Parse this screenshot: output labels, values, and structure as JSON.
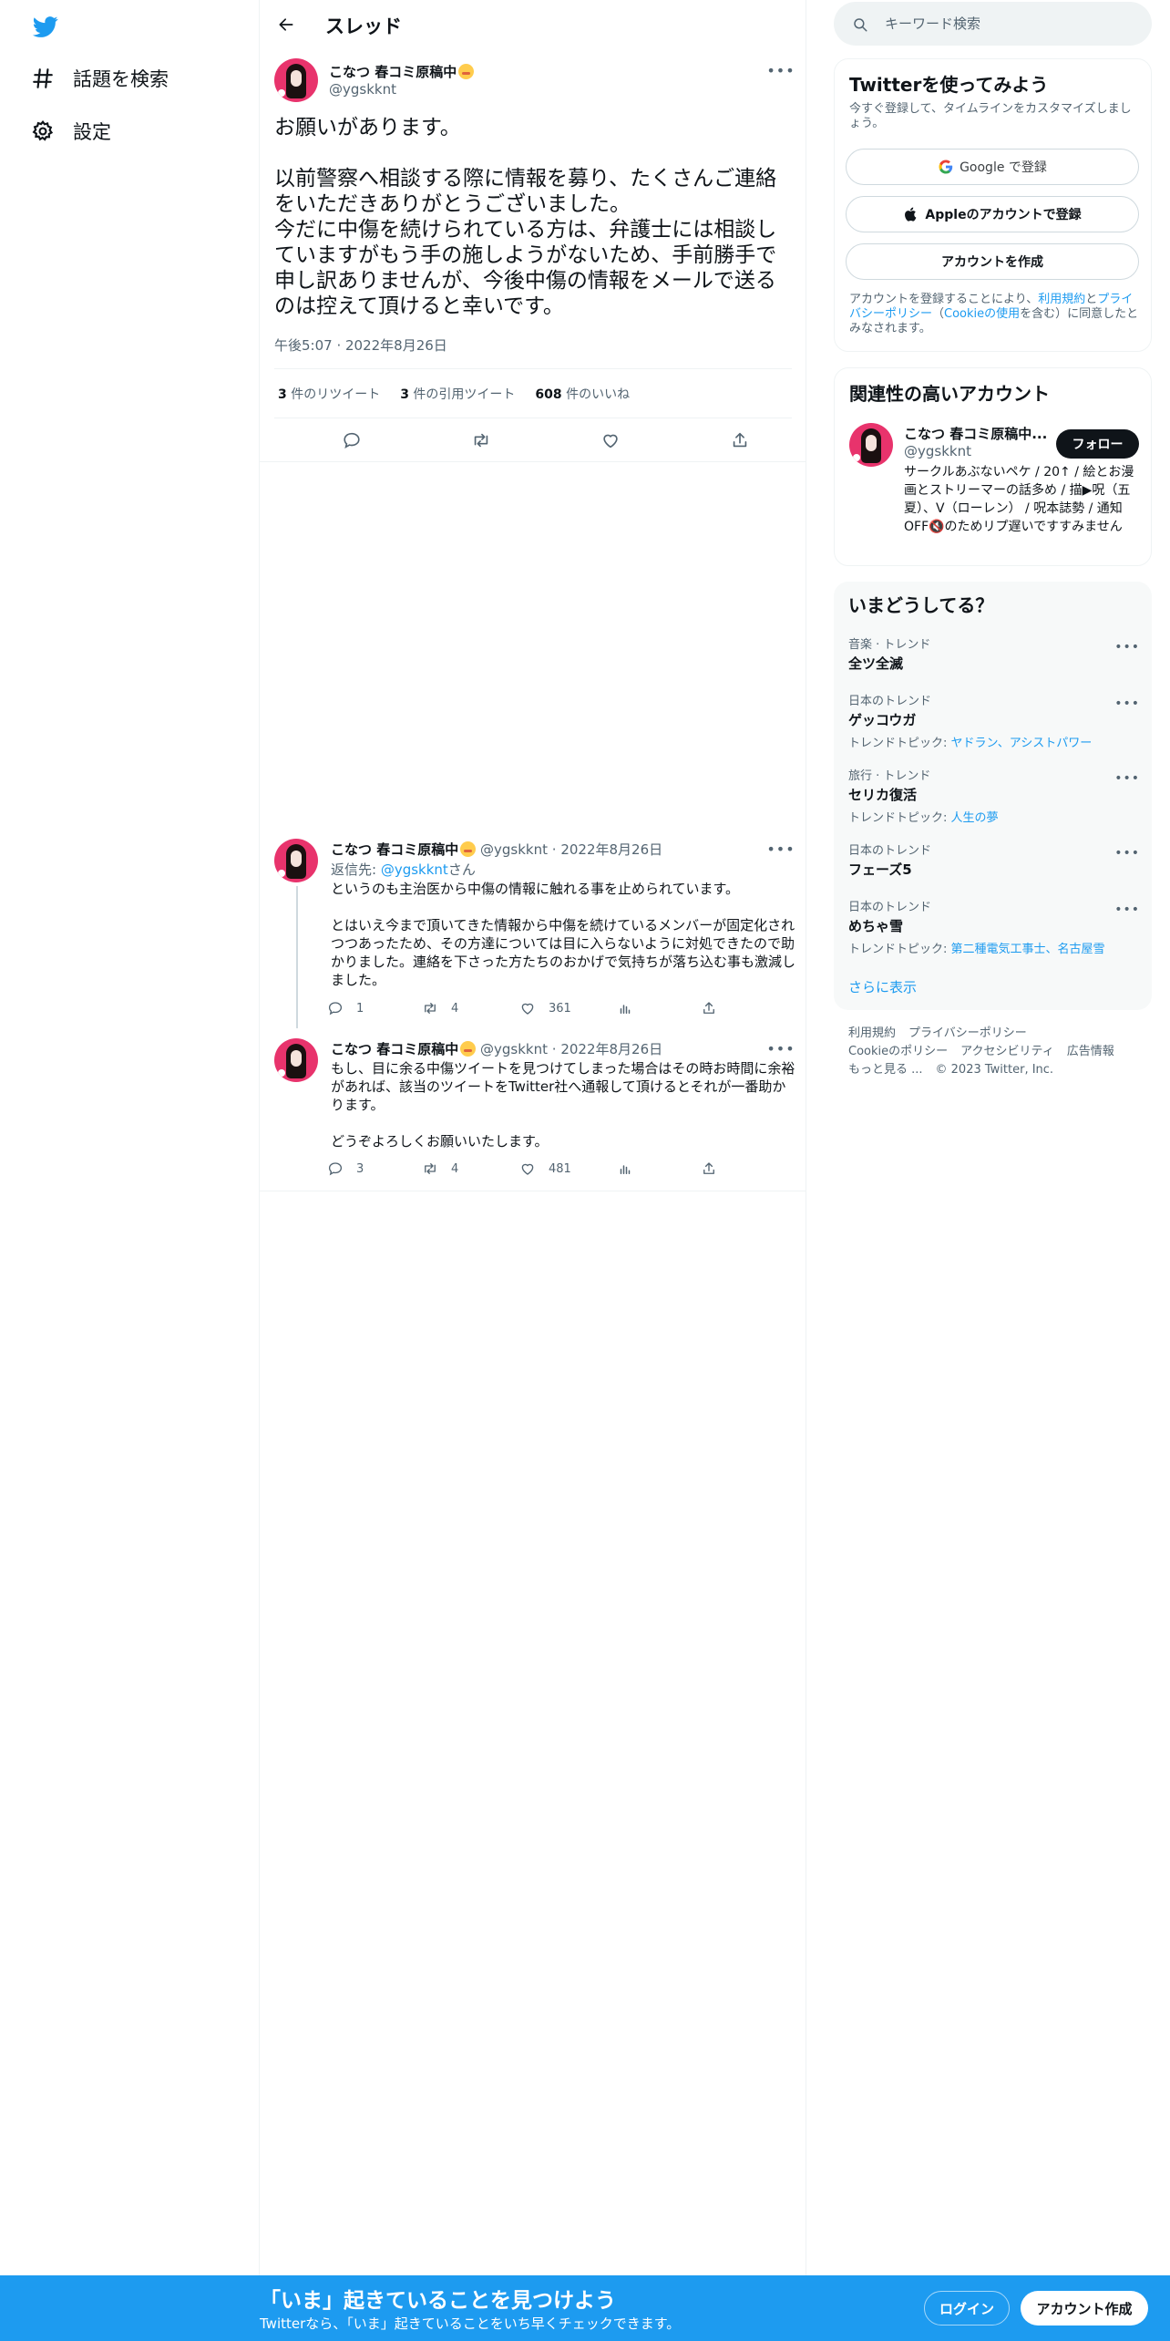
{
  "nav": {
    "explore_label": "話題を検索",
    "settings_label": "設定"
  },
  "thread": {
    "title": "スレッド",
    "main_tweet": {
      "display_name": "こなつ 春コミ原稿中",
      "handle": "@ygskknt",
      "text": "お願いがあります。\n\n以前警察へ相談する際に情報を募り、たくさんご連絡をいただきありがとうございました。\n今だに中傷を続けられている方は、弁護士には相談していますがもう手の施しようがないため、手前勝手で申し訳ありませんが、今後中傷の情報をメールで送るのは控えて頂けると幸いです。",
      "time": "午後5:07",
      "date": "2022年8月26日",
      "retweets_count": "3",
      "retweets_label": "件のリツイート",
      "quotes_count": "3",
      "quotes_label": "件の引用ツイート",
      "likes_count": "608",
      "likes_label": "件のいいね"
    },
    "replies": [
      {
        "display_name": "こなつ 春コミ原稿中",
        "handle": "@ygskknt",
        "date": "2022年8月26日",
        "reply_to_prefix": "返信先: ",
        "reply_to_handle": "@ygskknt",
        "reply_to_suffix": "さん",
        "text": "というのも主治医から中傷の情報に触れる事を止められています。\n\nとはいえ今まで頂いてきた情報から中傷を続けているメンバーが固定化されつつあったため、その方達については目に入らないように対処できたので助かりました。連絡を下さった方たちのおかげで気持ちが落ち込む事も激減しました。",
        "reply_count": "1",
        "retweet_count": "4",
        "like_count": "361"
      },
      {
        "display_name": "こなつ 春コミ原稿中",
        "handle": "@ygskknt",
        "date": "2022年8月26日",
        "text": "もし、目に余る中傷ツイートを見つけてしまった場合はその時お時間に余裕があれば、該当のツイートをTwitter社へ通報して頂けるとそれが一番助かります。\n\nどうぞよろしくお願いいたします。",
        "reply_count": "3",
        "retweet_count": "4",
        "like_count": "481"
      }
    ]
  },
  "search": {
    "placeholder": "キーワード検索"
  },
  "signup_card": {
    "title": "Twitterを使ってみよう",
    "subtitle": "今すぐ登録して、タイムラインをカスタマイズしましょう。",
    "google_label": "Google で登録",
    "apple_label": "Appleのアカウントで登録",
    "create_label": "アカウントを作成",
    "legal_prefix": "アカウントを登録することにより、",
    "terms_link": "利用規約",
    "legal_and": "と",
    "privacy_link": "プライバシーポリシー",
    "legal_paren_open": "（",
    "cookie_link": "Cookieの使用",
    "legal_suffix": "を含む）に同意したとみなされます。"
  },
  "related_card": {
    "title": "関連性の高いアカウント",
    "display_name": "こなつ 春コミ原稿中...",
    "handle": "@ygskknt",
    "follow_label": "フォロー",
    "bio": "サークルあぶないペケ / 20↑ / 絵とお漫画とストリーマーの話多め / 描▶呪（五夏）、V（ローレン） / 呪本誌勢 / 通知OFF🔇のためリプ遅いですすみません"
  },
  "trends_card": {
    "title": "いまどうしてる？",
    "topic_prefix": "トレンドトピック: ",
    "items": [
      {
        "category": "音楽 · トレンド",
        "name": "全ツ全滅",
        "topics": ""
      },
      {
        "category": "日本のトレンド",
        "name": "ゲッコウガ",
        "topics": "ヤドラン、アシストパワー"
      },
      {
        "category": "旅行 · トレンド",
        "name": "セリカ復活",
        "topics": "人生の夢"
      },
      {
        "category": "日本のトレンド",
        "name": "フェーズ5",
        "topics": ""
      },
      {
        "category": "日本のトレンド",
        "name": "めちゃ雪",
        "topics": "第二種電気工事士、名古屋雪"
      }
    ],
    "show_more": "さらに表示"
  },
  "footer": {
    "terms": "利用規約",
    "privacy": "プライバシーポリシー",
    "cookie": "Cookieのポリシー",
    "accessibility": "アクセシビリティ",
    "ads": "広告情報",
    "more": "もっと見る ...",
    "copyright": "© 2023 Twitter, Inc."
  },
  "bottom_bar": {
    "title": "「いま」起きていることを見つけよう",
    "subtitle": "Twitterなら、「いま」起きていることをいち早くチェックできます。",
    "login_label": "ログイン",
    "signup_label": "アカウント作成"
  },
  "colors": {
    "brand": "#1d9bf0",
    "text": "#0f1419",
    "muted": "#536471",
    "avatar_bg": "#e8336c"
  },
  "icons": [
    "twitter-bird-icon",
    "hashtag-icon",
    "gear-icon",
    "arrow-left-icon",
    "more-icon",
    "reply-icon",
    "retweet-icon",
    "like-icon",
    "share-icon",
    "views-icon",
    "search-icon",
    "google-icon",
    "apple-icon"
  ]
}
